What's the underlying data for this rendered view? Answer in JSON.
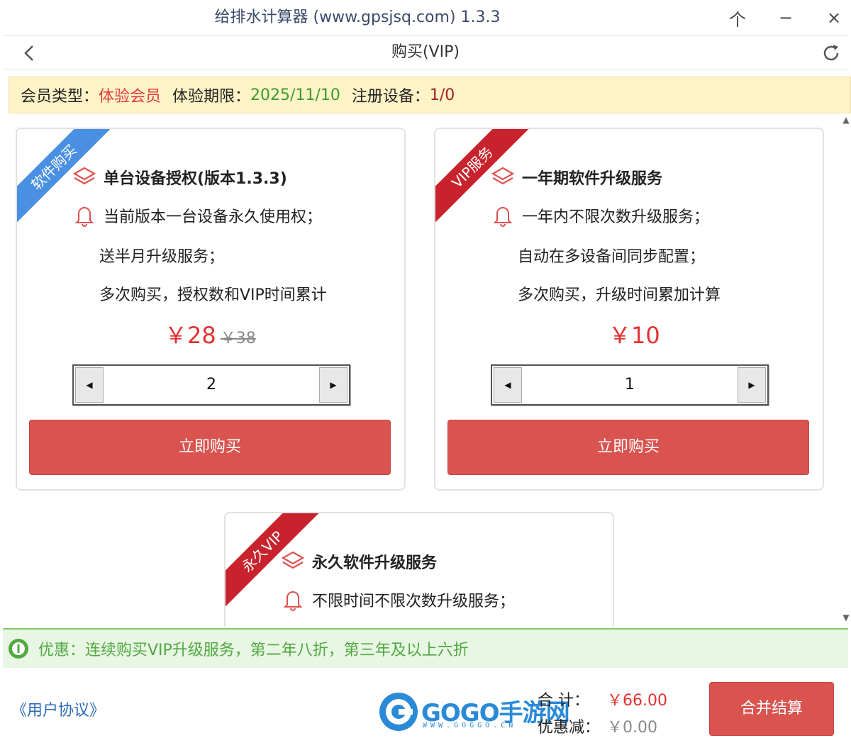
{
  "window": {
    "title": "给排水计算器 (www.gpsjsq.com) 1.3.3",
    "pin_glyph": "个",
    "min_glyph": "−",
    "close_glyph": "×"
  },
  "nav": {
    "title": "购买(VIP)"
  },
  "member": {
    "type_label": "会员类型：",
    "type_value": "体验会员",
    "expiry_label": "体验期限：",
    "expiry_value": "2025/11/10",
    "devices_label": "注册设备：",
    "devices_value": "1/0"
  },
  "cards": [
    {
      "ribbon": "软件购买",
      "title": "单台设备授权(版本1.3.3)",
      "lines": [
        "当前版本一台设备永久使用权；",
        "送半月升级服务；",
        "多次购买，授权数和VIP时间累计"
      ],
      "price": "￥28",
      "original_price": "￥38",
      "quantity": "2",
      "buy_label": "立即购买"
    },
    {
      "ribbon": "VIP服务",
      "title": "一年期软件升级服务",
      "lines": [
        "一年内不限次数升级服务；",
        "自动在多设备间同步配置；",
        "多次购买，升级时间累加计算"
      ],
      "price": "￥10",
      "quantity": "1",
      "buy_label": "立即购买"
    },
    {
      "ribbon": "永久VIP",
      "title": "永久软件升级服务",
      "lines": [
        "不限时间不限次数升级服务；"
      ]
    }
  ],
  "promo": {
    "text": "优惠：连续购买VIP升级服务，第二年八折，第三年及以上六折"
  },
  "footer": {
    "agreement": "《用户协议》",
    "logo_text": "GOGO手游网",
    "logo_sub": "WWW.GOGGO.CN",
    "total_label": "合  计：",
    "total_value": "￥66.00",
    "discount_label": "优惠减：",
    "discount_value": "￥0.00",
    "checkout_label": "合并结算"
  },
  "colors": {
    "accent_red": "#d9534f",
    "price_red": "#e23232",
    "member_bar_bg": "#fdf3c7",
    "promo_green": "#52a842",
    "ribbon_blue": "#4a90e2",
    "ribbon_red": "#c8232c"
  },
  "icons": {
    "back": "chevron-left-icon",
    "refresh": "refresh-icon",
    "layers": "layers-icon",
    "bell": "bell-icon",
    "info": "info-icon"
  }
}
